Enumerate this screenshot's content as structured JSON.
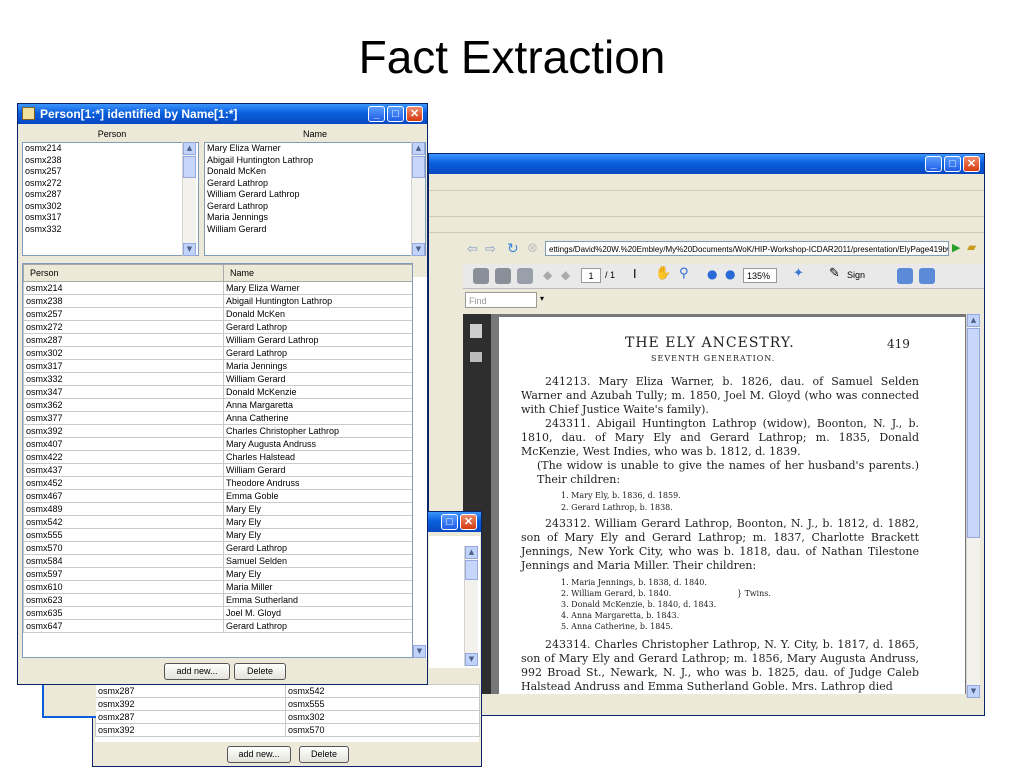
{
  "slide": {
    "title": "Fact Extraction"
  },
  "front_window": {
    "title": "Person[1:*] identified by Name[1:*]",
    "list_headers": {
      "person": "Person",
      "name": "Name"
    },
    "person_list": [
      "osmx214",
      "osmx238",
      "osmx257",
      "osmx272",
      "osmx287",
      "osmx302",
      "osmx317",
      "osmx332"
    ],
    "name_list": [
      "Mary Eliza Warner",
      "Abigail Huntington Lathrop",
      "Donald McKen",
      "Gerard Lathrop",
      "William Gerard Lathrop",
      "Gerard Lathrop",
      "Maria Jennings",
      "William Gerard"
    ],
    "table_headers": {
      "person": "Person",
      "name": "Name"
    },
    "rows": [
      [
        "osmx214",
        "Mary Eliza Warner"
      ],
      [
        "osmx238",
        "Abigail Huntington Lathrop"
      ],
      [
        "osmx257",
        "Donald McKen"
      ],
      [
        "osmx272",
        "Gerard Lathrop"
      ],
      [
        "osmx287",
        "William Gerard Lathrop"
      ],
      [
        "osmx302",
        "Gerard Lathrop"
      ],
      [
        "osmx317",
        "Maria Jennings"
      ],
      [
        "osmx332",
        "William Gerard"
      ],
      [
        "osmx347",
        "Donald McKenzie"
      ],
      [
        "osmx362",
        "Anna Margaretta"
      ],
      [
        "osmx377",
        "Anna Catherine"
      ],
      [
        "osmx392",
        "Charles Christopher Lathrop"
      ],
      [
        "osmx407",
        "Mary Augusta Andruss"
      ],
      [
        "osmx422",
        "Charles Halstead"
      ],
      [
        "osmx437",
        "William Gerard"
      ],
      [
        "osmx452",
        "Theodore Andruss"
      ],
      [
        "osmx467",
        "Emma Goble"
      ],
      [
        "osmx489",
        "Mary Ely"
      ],
      [
        "osmx542",
        "Mary Ely"
      ],
      [
        "osmx555",
        "Mary Ely"
      ],
      [
        "osmx570",
        "Gerard Lathrop"
      ],
      [
        "osmx584",
        "Samuel Selden"
      ],
      [
        "osmx597",
        "Mary Ely"
      ],
      [
        "osmx610",
        "Maria Miller"
      ],
      [
        "osmx623",
        "Emma Sutherland"
      ],
      [
        "osmx635",
        "Joel M. Gloyd"
      ],
      [
        "osmx647",
        "Gerard Lathrop"
      ]
    ],
    "add_label": "add new...",
    "delete_label": "Delete"
  },
  "back_window": {
    "rows": [
      [
        "osmx287",
        "osmx542"
      ],
      [
        "osmx392",
        "osmx555"
      ],
      [
        "osmx287",
        "osmx302"
      ],
      [
        "osmx392",
        "osmx570"
      ]
    ],
    "add_label": "add new...",
    "delete_label": "Delete"
  },
  "pdf_window": {
    "address": "ettings/David%20W.%20Embley/My%20Documents/WoK/HIP-Workshop-ICDAR2011/presentation/ElyPage419bw.pdf",
    "page_number": "1",
    "page_total": "/ 1",
    "zoom": "135%",
    "sign_label": "Sign",
    "find_placeholder": "Find",
    "doc": {
      "heading": "THE ELY ANCESTRY.",
      "page_no": "419",
      "subheading": "SEVENTH GENERATION.",
      "para1": "241213. Mary Eliza Warner, b. 1826, dau. of Samuel Selden Warner and Azubah Tully; m. 1850, Joel M. Gloyd (who was connected with Chief Justice Waite's family).",
      "para2": "243311. Abigail Huntington Lathrop (widow), Boonton, N. J., b. 1810, dau. of Mary Ely and Gerard Lathrop; m. 1835, Donald McKenzie, West Indies, who was b. 1812, d. 1839.",
      "para3": "(The widow is unable to give the names of her husband's parents.) Their children:",
      "children1": [
        "1. Mary Ely, b. 1836, d. 1859.",
        "2. Gerard Lathrop, b. 1838."
      ],
      "para4": "243312. William Gerard Lathrop, Boonton, N. J., b. 1812, d. 1882, son of Mary Ely and Gerard Lathrop; m. 1837, Charlotte Brackett Jennings, New York City, who was b. 1818, dau. of Nathan Tilestone Jennings and Maria Miller. Their children:",
      "children2": [
        "1. Maria Jennings, b. 1838, d. 1840.",
        "2. William Gerard, b. 1840.",
        "3. Donald McKenzie, b. 1840, d. 1843.",
        "4. Anna Margaretta, b. 1843.",
        "5. Anna Catherine, b. 1845."
      ],
      "twins": "Twins.",
      "para5": "243314. Charles Christopher Lathrop, N. Y. City, b. 1817, d. 1865, son of Mary Ely and Gerard Lathrop; m. 1856, Mary Augusta Andruss, 992 Broad St., Newark, N. J., who was b. 1825, dau. of Judge Caleb Halstead Andruss and Emma Sutherland Goble. Mrs. Lathrop died"
    }
  }
}
